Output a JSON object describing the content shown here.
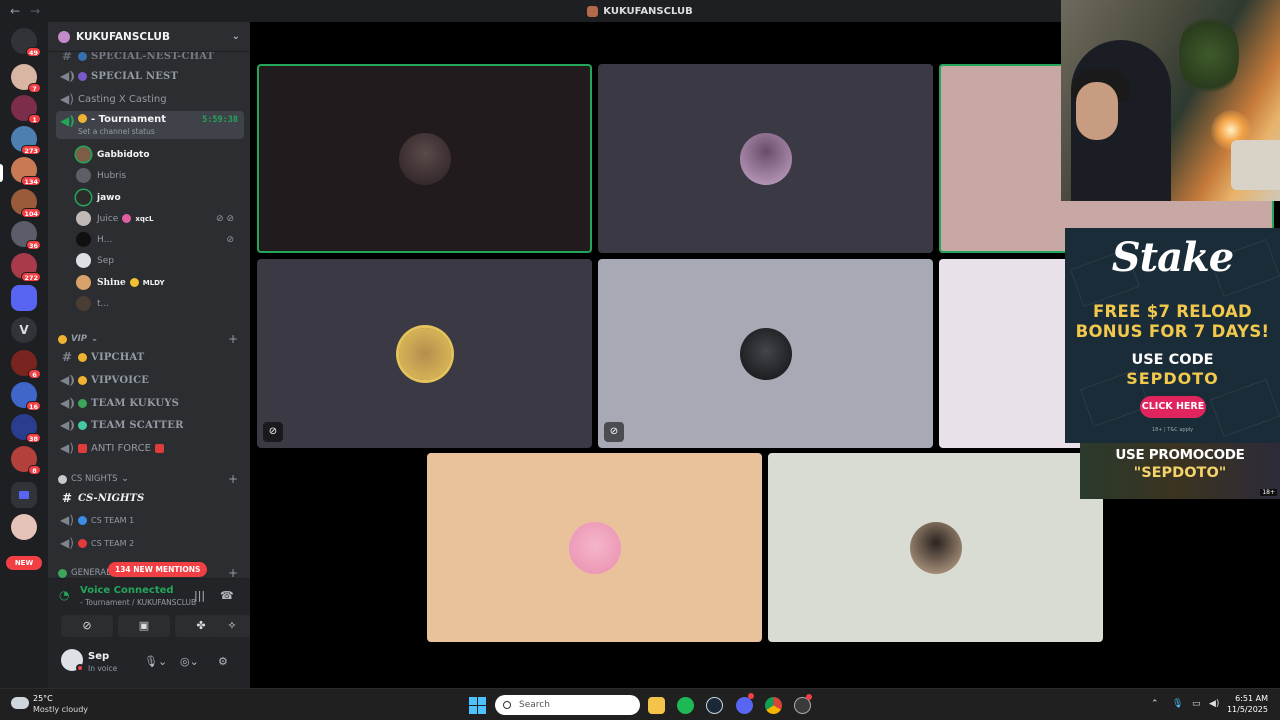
{
  "titlebar": {
    "title": "KUKUFANSCLUB",
    "back": "←",
    "forward": "→"
  },
  "rail": {
    "badges": [
      "49",
      "7",
      "1",
      "273",
      "134",
      "104",
      "36",
      "272",
      "6",
      "16",
      "38",
      "8"
    ],
    "letter": "V",
    "new_label": "NEW"
  },
  "sidebar": {
    "guild_name": "KUKUFANSCLUB",
    "channels_top": [
      {
        "name": "SPECIAL-NEST-CHAT",
        "type": "text"
      },
      {
        "name": "SPECIAL NEST",
        "type": "voice"
      },
      {
        "name": "Casting X Casting",
        "type": "voice"
      }
    ],
    "active_channel": {
      "name": "- Tournament",
      "timer": "5:59:38",
      "status": "Set a channel status"
    },
    "members": [
      {
        "name": "Gabbidoto",
        "tag": ""
      },
      {
        "name": "Hubris",
        "tag": ""
      },
      {
        "name": "jawo",
        "tag": ""
      },
      {
        "name": "Juice",
        "tag": "xqcL"
      },
      {
        "name": "H...",
        "tag": ""
      },
      {
        "name": "Sep",
        "tag": ""
      },
      {
        "name": "Shine",
        "tag": "MLDY"
      },
      {
        "name": "t...",
        "tag": ""
      }
    ],
    "cat_vip": "VIP",
    "vip_channels": [
      "VIPCHAT",
      "VIPVOICE",
      "TEAM KUKUYS",
      "TEAM SCATTER",
      "ANTI FORCE"
    ],
    "cat_cs": "CS NIGHTS",
    "cs_channels": [
      "CS-NIGHTS",
      "CS TEAM 1",
      "CS TEAM 2"
    ],
    "cat_general": "GENERAL",
    "new_mentions": "134 NEW MENTIONS"
  },
  "voice_panel": {
    "status": "Voice Connected",
    "location": "- Tournament / KUKUFANSCLUB"
  },
  "user_panel": {
    "name": "Sep",
    "status": "In voice"
  },
  "ads": {
    "brand": "Stake",
    "line1": "FREE $7 RELOAD",
    "line2": "BONUS FOR 7 DAYS!",
    "line3": "USE CODE",
    "line4": "SEPDOTO",
    "cta": "CLICK HERE",
    "fine": "18+ | T&C apply",
    "promo1": "USE PROMOCODE",
    "promo2": "\"SEPDOTO\"",
    "age": "18+"
  },
  "taskbar": {
    "temp": "25°C",
    "weather": "Mostly cloudy",
    "search": "Search",
    "time": "6:51 AM",
    "date": "11/5/2025"
  },
  "colors": {
    "discord_green": "#23a55a",
    "discord_red": "#f23f43",
    "tile_pink": "#c8a8a5",
    "tile_peach": "#e9c19b"
  }
}
